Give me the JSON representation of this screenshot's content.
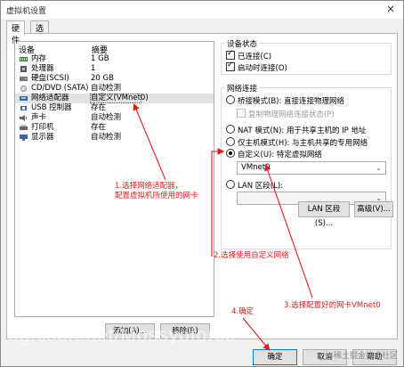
{
  "window": {
    "title": "虚拟机设置",
    "close_glyph": "✕"
  },
  "tabs": [
    {
      "label": "硬件"
    },
    {
      "label": "选项"
    }
  ],
  "device_list": {
    "header_device": "设备",
    "header_summary": "摘要",
    "rows": [
      {
        "name": "内存",
        "summary": "1 GB"
      },
      {
        "name": "处理器",
        "summary": "1"
      },
      {
        "name": "硬盘(SCSI)",
        "summary": "20 GB"
      },
      {
        "name": "CD/DVD (SATA)",
        "summary": "自动检测"
      },
      {
        "name": "网络适配器",
        "summary": "自定义(VMnet0)"
      },
      {
        "name": "USB 控制器",
        "summary": "存在"
      },
      {
        "name": "声卡",
        "summary": "自动检测"
      },
      {
        "name": "打印机",
        "summary": "存在"
      },
      {
        "name": "显示器",
        "summary": "自动检测"
      }
    ]
  },
  "device_buttons": {
    "add": "添加(A)...",
    "remove": "移除(R)"
  },
  "device_status": {
    "title": "设备状态",
    "connected": "已连接(C)",
    "connect_at_power_on": "启动时连接(O)",
    "connected_checked": true,
    "connect_at_power_on_checked": true
  },
  "network_connection": {
    "title": "网络连接",
    "bridged": "桥接模式(B): 直接连接物理网络",
    "replicate": "复制物理网络连接状态(P)",
    "nat": "NAT 模式(N): 用于共享主机的 IP 地址",
    "host_only": "仅主机模式(H): 与主机共享的专用网络",
    "custom": "自定义(U): 特定虚拟网络",
    "custom_value": "VMnet0",
    "lan_segment": "LAN 区段(L):",
    "lan_segment_value": "",
    "selected": "custom"
  },
  "panel_buttons": {
    "lan_segments": "LAN 区段(S)...",
    "advanced": "高级(V)..."
  },
  "footer_buttons": {
    "ok": "确定",
    "cancel": "取消",
    "help": "帮助"
  },
  "annotations": {
    "step1_line1": "1.选择网络适配器，",
    "step1_line2": "配置虚拟机所使用的网卡",
    "step2": "2.选择使用自定义网络",
    "step3": "3.选择配置好的网卡VMnet0",
    "step4": "4.确定"
  },
  "colors": {
    "annotation": "#e21b1b",
    "accent": "#0078d7"
  },
  "watermarks": {
    "url_overlay": "og.csdn.net/Mossyoforce",
    "corner": "@稀土掘金技术社区"
  }
}
